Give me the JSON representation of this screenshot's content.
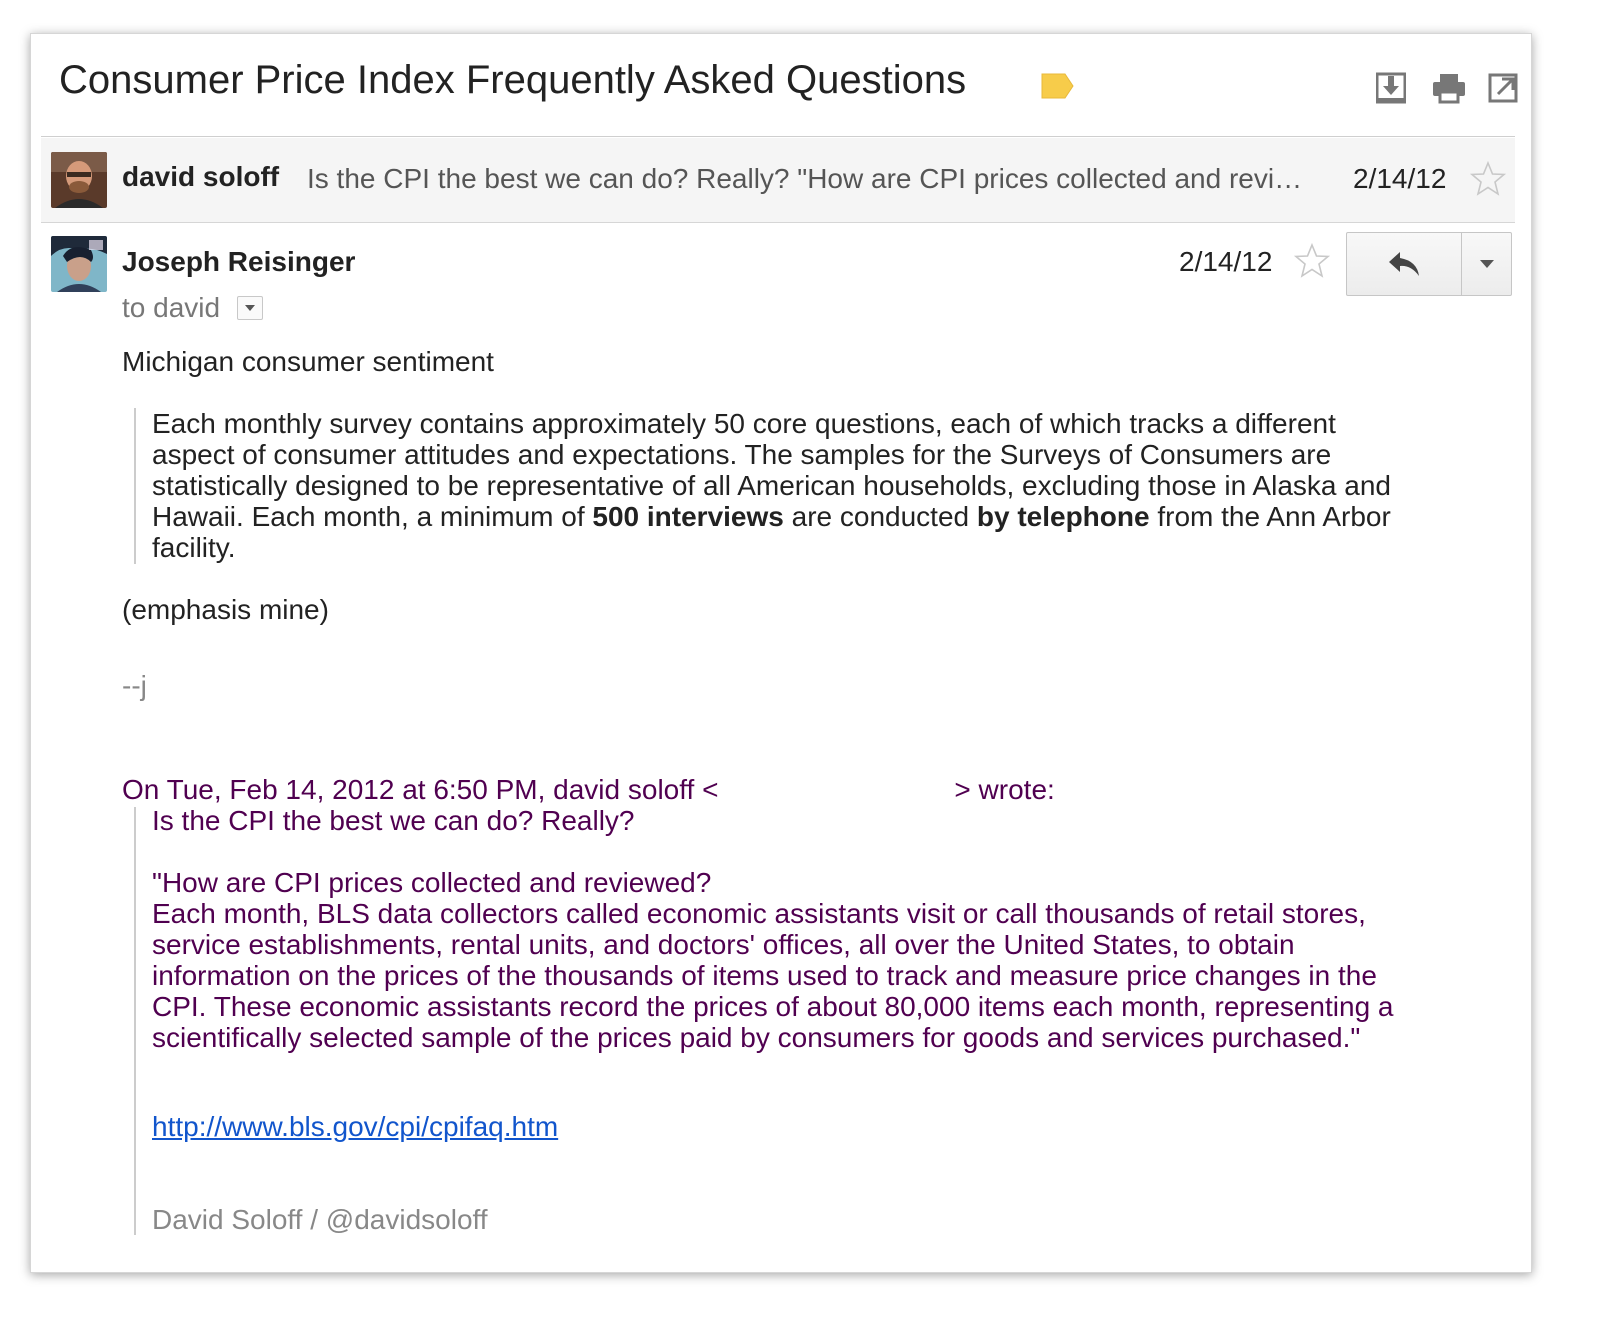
{
  "thread": {
    "subject": "Consumer Price Index Frequently Asked Questions",
    "toolbar": {
      "download_icon": "download-icon",
      "print_icon": "print-icon",
      "popout_icon": "open-in-new-window-icon"
    }
  },
  "collapsed_message": {
    "sender": "david soloff",
    "snippet": "Is the CPI the best we can do? Really? \"How are CPI prices collected and revi…",
    "date": "2/14/12"
  },
  "message": {
    "sender": "Joseph Reisinger",
    "to_line": "to david",
    "date": "2/14/12",
    "body": {
      "intro": "Michigan consumer sentiment",
      "quote_lines": [
        "Each monthly survey contains approximately 50 core questions, each of which tracks a different",
        "aspect of consumer attitudes and expectations.  The samples for the Surveys of Consumers are",
        "statistically designed to be representative of all American households, excluding those in Alaska and"
      ],
      "quote_line4": {
        "a": "Hawaii.  Each month, a minimum of ",
        "bold1": "500 interviews",
        "b": " are conducted ",
        "bold2": "by telephone",
        "c": " from the Ann Arbor"
      },
      "quote_line5": "facility.",
      "emphasis": "(emphasis mine)",
      "signoff": "--j"
    },
    "quoted": {
      "attribution_start": "On Tue, Feb 14, 2012 at 6:50 PM, david soloff <",
      "attribution_end": "> wrote:",
      "line1": "Is the CPI the best we can do? Really?",
      "question": "\"How are CPI prices collected and reviewed?",
      "paragraph_lines": [
        "Each month, BLS data collectors called economic assistants visit or call thousands of retail stores,",
        "service establishments, rental units, and doctors' offices, all over the United States, to obtain",
        "information on the prices of the thousands of items used to track and measure price changes in the",
        "CPI. These economic assistants record the prices of about 80,000 items each month, representing a",
        "scientifically selected sample of the prices paid by consumers for goods and services purchased.\""
      ],
      "link": "http://www.bls.gov/cpi/cpifaq.htm",
      "signature": "David Soloff / @davidsoloff"
    }
  },
  "icons": {
    "label": "label-tag-icon",
    "star": "star-icon",
    "reply": "reply-icon",
    "more": "chevron-down-icon"
  },
  "colors": {
    "label_tag": "#f7cc4a",
    "quoted_text": "#500050",
    "link": "#1155cc"
  }
}
